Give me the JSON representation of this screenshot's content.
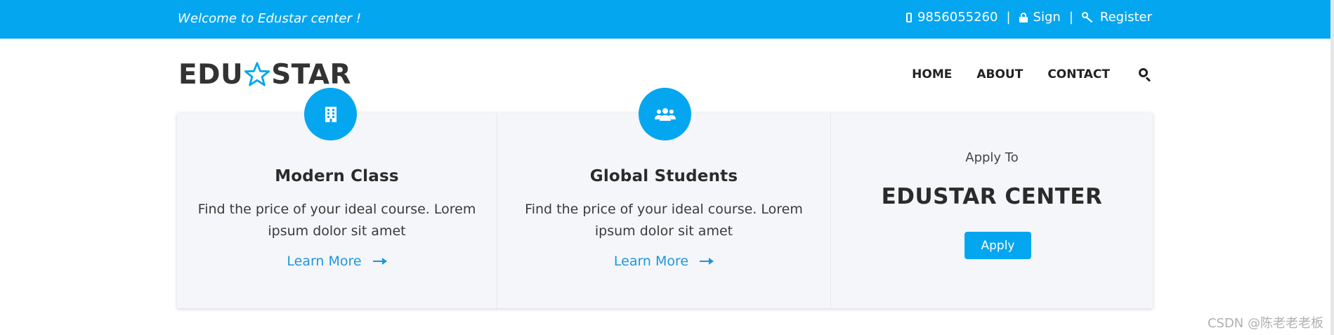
{
  "topbar": {
    "welcome": "Welcome to Edustar center !",
    "phone": "9856055260",
    "separator": "|",
    "sign": "Sign",
    "register": "Register"
  },
  "header": {
    "logo_left": "EDU",
    "logo_right": "STAR",
    "nav": [
      "HOME",
      "ABOUT",
      "CONTACT"
    ]
  },
  "cards": [
    {
      "icon": "building-icon",
      "title": "Modern Class",
      "text": "Find the price of your ideal course. Lorem ipsum dolor sit amet",
      "link": "Learn More"
    },
    {
      "icon": "users-icon",
      "title": "Global Students",
      "text": "Find the price of your ideal course. Lorem ipsum dolor sit amet",
      "link": "Learn More"
    }
  ],
  "apply": {
    "pre": "Apply To",
    "title": "EDUSTAR CENTER",
    "button": "Apply"
  },
  "watermark": "CSDN @陈老老老板",
  "colors": {
    "accent": "#05a6f0",
    "link": "#1e96de",
    "panel_bg": "#f5f6f9",
    "text_dark": "#2b2b2b"
  }
}
